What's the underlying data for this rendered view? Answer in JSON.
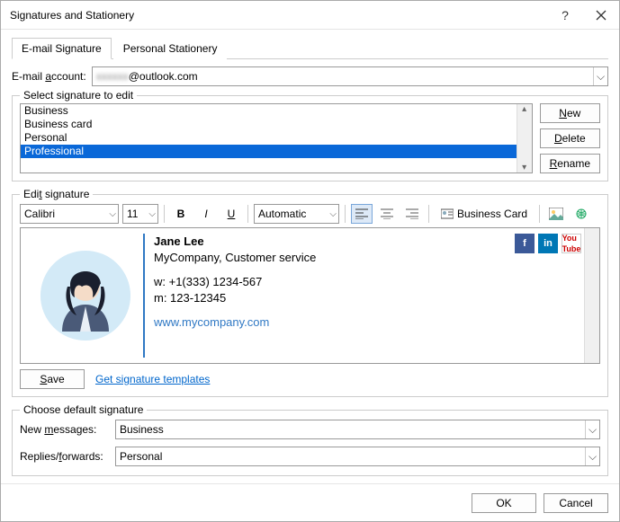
{
  "window": {
    "title": "Signatures and Stationery"
  },
  "tabs": {
    "email": "E-mail Signature",
    "stationery": "Personal Stationery"
  },
  "accountLabel": "E-mail account:",
  "account": {
    "value": "@outlook.com"
  },
  "selectSig": {
    "legend": "Select signature to edit",
    "items": [
      "Business",
      "Business card",
      "Personal",
      "Professional"
    ],
    "selectedIndex": 3
  },
  "buttons": {
    "new": "New",
    "delete": "Delete",
    "rename": "Rename",
    "save": "Save",
    "ok": "OK",
    "cancel": "Cancel"
  },
  "editSig": {
    "legend": "Edit signature",
    "font": "Calibri",
    "size": "11",
    "colorLabel": "Automatic",
    "businessCard": "Business Card"
  },
  "signature": {
    "name": "Jane Lee",
    "company": "MyCompany, Customer service",
    "work": "w: +1(333) 1234-567",
    "mobile": "m: 123-12345",
    "website": "www.mycompany.com"
  },
  "templatesLink": "Get signature templates",
  "defaults": {
    "legend": "Choose default signature",
    "newLabel": "New messages:",
    "newValue": "Business",
    "replyLabel": "Replies/forwards:",
    "replyValue": "Personal"
  }
}
